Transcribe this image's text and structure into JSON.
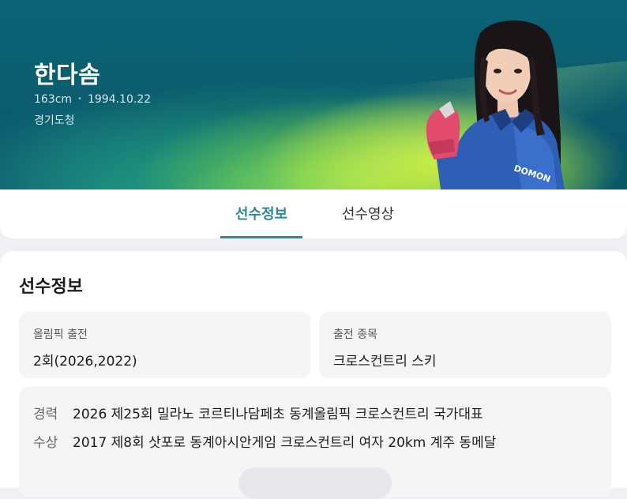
{
  "athlete": {
    "name": "한다솜",
    "height": "163cm",
    "separator": "•",
    "birth": "1994.10.22",
    "team": "경기도청"
  },
  "tabs": [
    {
      "label": "선수정보",
      "active": true
    },
    {
      "label": "선수영상",
      "active": false
    }
  ],
  "section_title": "선수정보",
  "info": [
    {
      "label": "올림픽 출전",
      "value": "2회(2026,2022)"
    },
    {
      "label": "출전 종목",
      "value": "크로스컨트리 스키"
    }
  ],
  "records": [
    {
      "key": "경력",
      "value": "2026 제25회 밀라노 코르티나담페초 동계올림픽 크로스컨트리 국가대표"
    },
    {
      "key": "수상",
      "value": "2017 제8회 삿포로 동계아시안게임 크로스컨트리 여자 20km 계주 동메달"
    }
  ],
  "colors": {
    "accent": "#2a8b93",
    "hero_base": "#0a6376",
    "hero_highlight": "#d6f03c"
  },
  "photo_text": "DOMON"
}
